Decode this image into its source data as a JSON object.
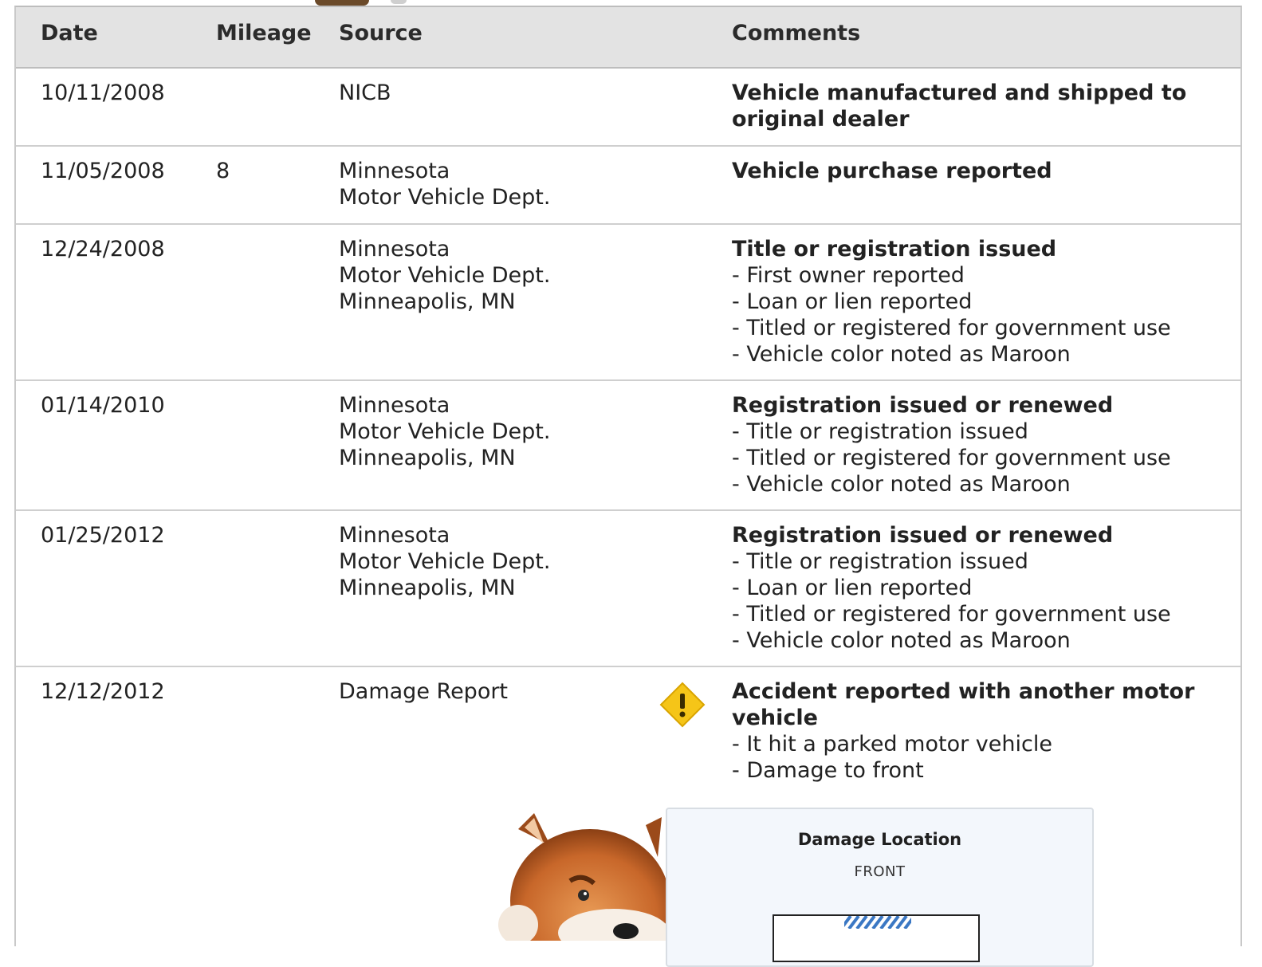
{
  "table": {
    "headers": {
      "date": "Date",
      "mileage": "Mileage",
      "source": "Source",
      "comments": "Comments"
    },
    "rows": [
      {
        "date": "10/11/2008",
        "mileage": "",
        "source": [
          "NICB"
        ],
        "comment_title": "Vehicle manufactured and shipped to original dealer",
        "comment_items": []
      },
      {
        "date": "11/05/2008",
        "mileage": "8",
        "source": [
          "Minnesota",
          "Motor Vehicle Dept."
        ],
        "comment_title": "Vehicle purchase reported",
        "comment_items": []
      },
      {
        "date": "12/24/2008",
        "mileage": "",
        "source": [
          "Minnesota",
          "Motor Vehicle Dept.",
          "Minneapolis, MN"
        ],
        "comment_title": "Title or registration issued",
        "comment_items": [
          "- First owner reported",
          "- Loan or lien reported",
          "- Titled or registered for government use",
          "- Vehicle color noted as Maroon"
        ]
      },
      {
        "date": "01/14/2010",
        "mileage": "",
        "source": [
          "Minnesota",
          "Motor Vehicle Dept.",
          "Minneapolis, MN"
        ],
        "comment_title": "Registration issued or renewed",
        "comment_items": [
          "- Title or registration issued",
          "- Titled or registered for government use",
          "- Vehicle color noted as Maroon"
        ]
      },
      {
        "date": "01/25/2012",
        "mileage": "",
        "source": [
          "Minnesota",
          "Motor Vehicle Dept.",
          "Minneapolis, MN"
        ],
        "comment_title": "Registration issued or renewed",
        "comment_items": [
          "- Title or registration issued",
          "- Loan or lien reported",
          "- Titled or registered for government use",
          "- Vehicle color noted as Maroon"
        ]
      },
      {
        "date": "12/12/2012",
        "mileage": "",
        "source": [
          "Damage Report"
        ],
        "comment_title": "Accident reported with another motor vehicle",
        "comment_items": [
          "- It hit a parked motor vehicle",
          "- Damage to front"
        ],
        "warning_icon": "warning-diamond-icon"
      }
    ]
  },
  "damage_card": {
    "title": "Damage Location",
    "subtitle": "FRONT"
  },
  "colors": {
    "header_bg": "#e3e3e3",
    "warning": "#f5c518",
    "card_bg": "#f3f7fc",
    "damage_stripe": "#3b78c4"
  }
}
